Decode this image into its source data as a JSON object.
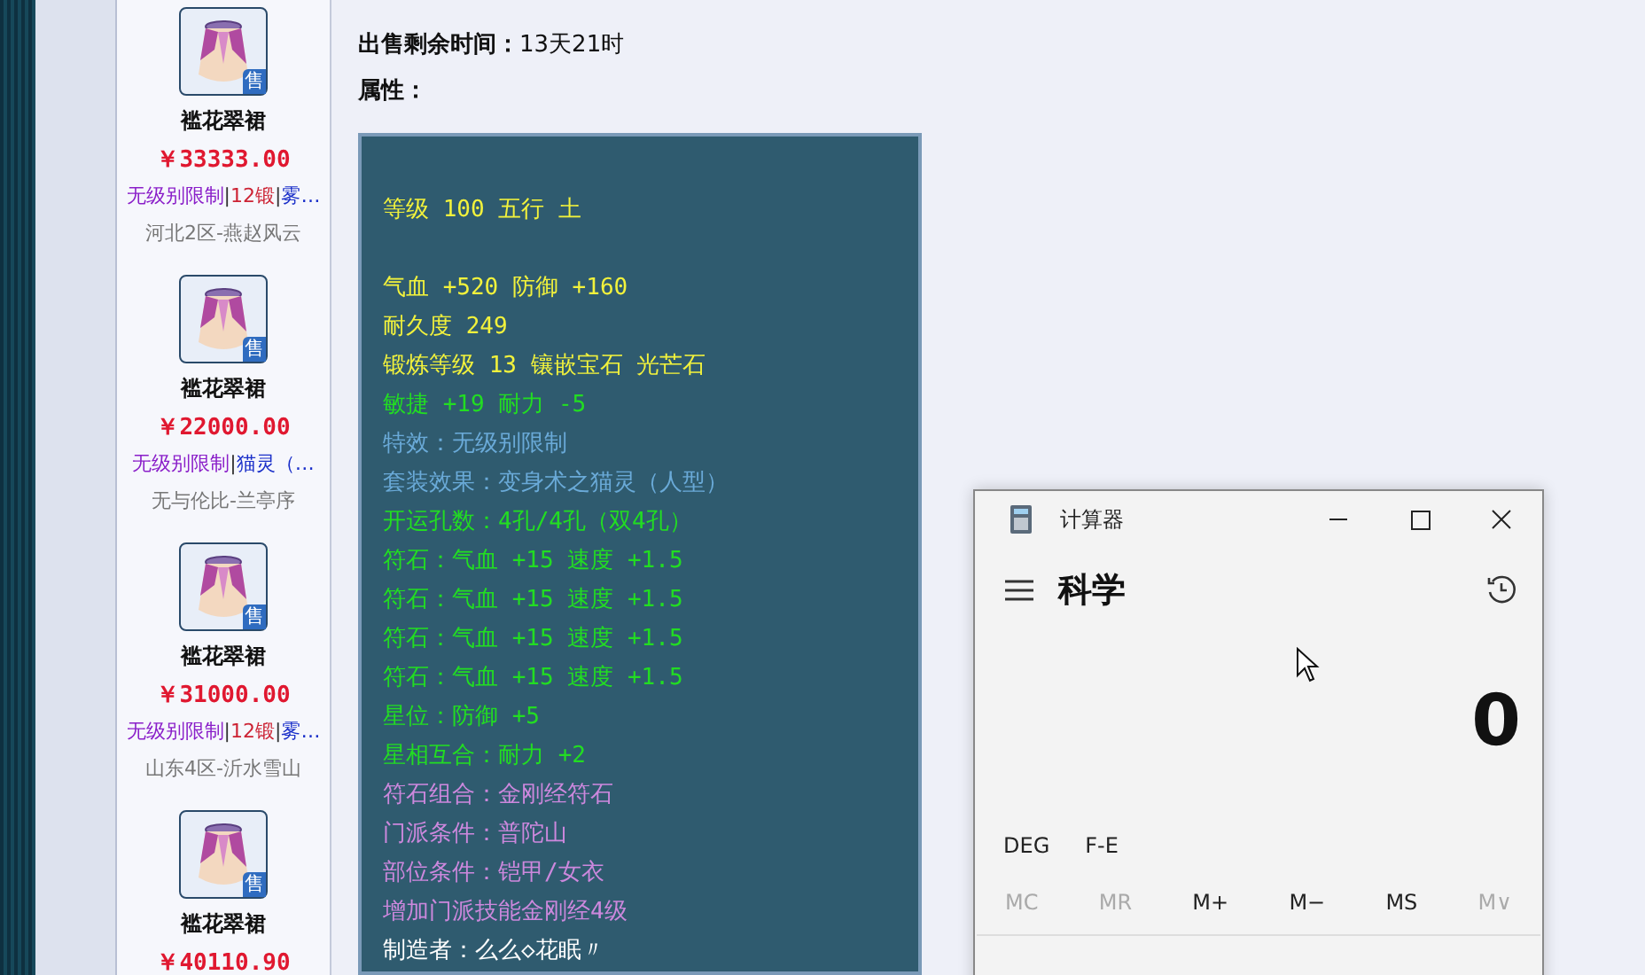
{
  "listings": [
    {
      "name": "褴花翠裙",
      "badge": "售",
      "price": "￥33333.00",
      "tags": [
        {
          "text": "无级别限制",
          "color": "#8a1fc9"
        },
        {
          "separator": "|",
          "text": "12锻",
          "color": "#cc2233"
        },
        {
          "separator": "|",
          "text": "雾…",
          "color": "#1a2fc9"
        }
      ],
      "server": "河北2区-燕赵风云"
    },
    {
      "name": "褴花翠裙",
      "badge": "售",
      "price": "￥22000.00",
      "tags": [
        {
          "text": "无级别限制",
          "color": "#8a1fc9"
        },
        {
          "separator": "|",
          "text": "猫灵（…",
          "color": "#1a2fc9"
        }
      ],
      "server": "无与伦比-兰亭序"
    },
    {
      "name": "褴花翠裙",
      "badge": "售",
      "price": "￥31000.00",
      "tags": [
        {
          "text": "无级别限制",
          "color": "#8a1fc9"
        },
        {
          "separator": "|",
          "text": "12锻",
          "color": "#cc2233"
        },
        {
          "separator": "|",
          "text": "雾…",
          "color": "#1a2fc9"
        }
      ],
      "server": "山东4区-沂水雪山"
    },
    {
      "name": "褴花翠裙",
      "badge": "售",
      "price": "￥40110.90"
    }
  ],
  "details": [
    {
      "label": "出售剩余时间：",
      "value": "13天21时"
    },
    {
      "label": "属性："
    }
  ],
  "attribute_sections": [
    [
      {
        "text": "等级 100 五行 土",
        "color": "#f2f23c"
      }
    ],
    [
      {
        "text": "气血 +520 防御 +160",
        "color": "#f2f23c"
      },
      {
        "text": "耐久度 249",
        "color": "#f2f23c"
      },
      {
        "text": "锻炼等级 13 镶嵌宝石 光芒石",
        "color": "#f2f23c"
      },
      {
        "text": "敏捷 +19 耐力 -5",
        "color": "#22dd22"
      },
      {
        "text": "特效：无级别限制",
        "color": "#6aaad8"
      },
      {
        "text": "套装效果：变身术之猫灵（人型）",
        "color": "#6aaad8"
      },
      {
        "text": "开运孔数：4孔/4孔（双4孔）",
        "color": "#22dd22"
      },
      {
        "text": "符石：气血 +15 速度 +1.5",
        "color": "#22dd22"
      },
      {
        "text": "符石：气血 +15 速度 +1.5",
        "color": "#22dd22"
      },
      {
        "text": "符石：气血 +15 速度 +1.5",
        "color": "#22dd22"
      },
      {
        "text": "符石：气血 +15 速度 +1.5",
        "color": "#22dd22"
      },
      {
        "text": "星位：防御 +5",
        "color": "#22dd22"
      },
      {
        "text": "星相互合：耐力 +2",
        "color": "#22dd22"
      },
      {
        "text": "符石组合：金刚经符石",
        "color": "#cc88dd"
      },
      {
        "text": "门派条件：普陀山",
        "color": "#cc88dd"
      },
      {
        "text": "部位条件：铠甲/女衣",
        "color": "#cc88dd"
      },
      {
        "text": "增加门派技能金刚经4级",
        "color": "#cc88dd"
      },
      {
        "text": "制造者：么么◇花眠〃",
        "color": "#ffffff"
      }
    ]
  ],
  "calculator": {
    "title": "计算器",
    "mode": "科学",
    "display": "0",
    "angle_buttons": [
      "DEG",
      "F-E"
    ],
    "memory_buttons": [
      {
        "label": "MC",
        "disabled": true
      },
      {
        "label": "MR",
        "disabled": true
      },
      {
        "label": "M+",
        "disabled": false
      },
      {
        "label": "M−",
        "disabled": false
      },
      {
        "label": "MS",
        "disabled": false
      },
      {
        "label": "M∨",
        "disabled": true
      }
    ]
  }
}
